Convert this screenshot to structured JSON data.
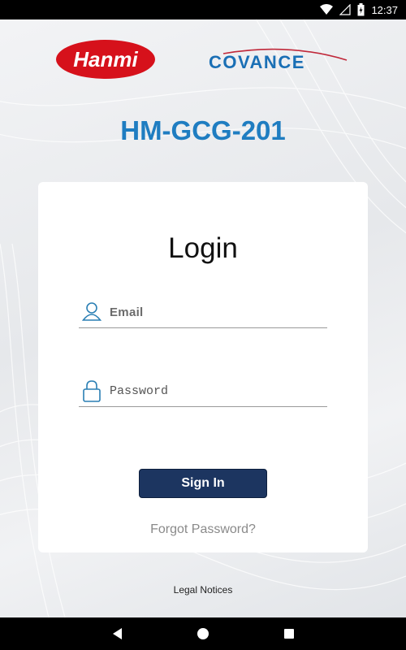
{
  "status_bar": {
    "time": "12:37",
    "icons": [
      "wifi-icon",
      "signal-off-icon",
      "battery-charging-icon"
    ]
  },
  "logos": {
    "hanmi": "Hanmi",
    "covance": "COVANCE"
  },
  "study_id": "HM-GCG-201",
  "login": {
    "title": "Login",
    "email_placeholder": "Email",
    "email_value": "",
    "password_placeholder": "Password",
    "password_value": "",
    "sign_in_label": "Sign In",
    "forgot_password_label": "Forgot Password?"
  },
  "footer": {
    "legal_notices_label": "Legal Notices"
  },
  "nav_bar": {
    "buttons": [
      "back-icon",
      "home-icon",
      "recents-icon"
    ]
  },
  "colors": {
    "brand_blue": "#1f7dc1",
    "button_navy": "#1c3560",
    "hanmi_red": "#d6111b",
    "covance_blue": "#1a6fb5"
  }
}
